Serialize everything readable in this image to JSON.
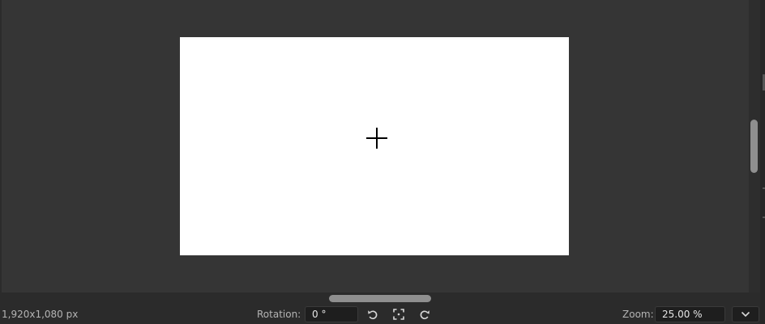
{
  "canvas": {
    "size_label": "1,920x1,080 px"
  },
  "rotation": {
    "label": "Rotation:",
    "value": "0 °"
  },
  "zoom": {
    "label": "Zoom:",
    "value": "25.00 %"
  },
  "icons": {
    "rotate_ccw": "rotate-counterclockwise-icon",
    "fit_view": "fit-to-view-icon",
    "rotate_cw": "rotate-clockwise-icon",
    "dropdown": "chevron-down-icon"
  },
  "colors": {
    "background": "#2b2b2b",
    "viewport": "#353535",
    "canvas": "#ffffff",
    "scroll_thumb": "#8f8f8f"
  }
}
